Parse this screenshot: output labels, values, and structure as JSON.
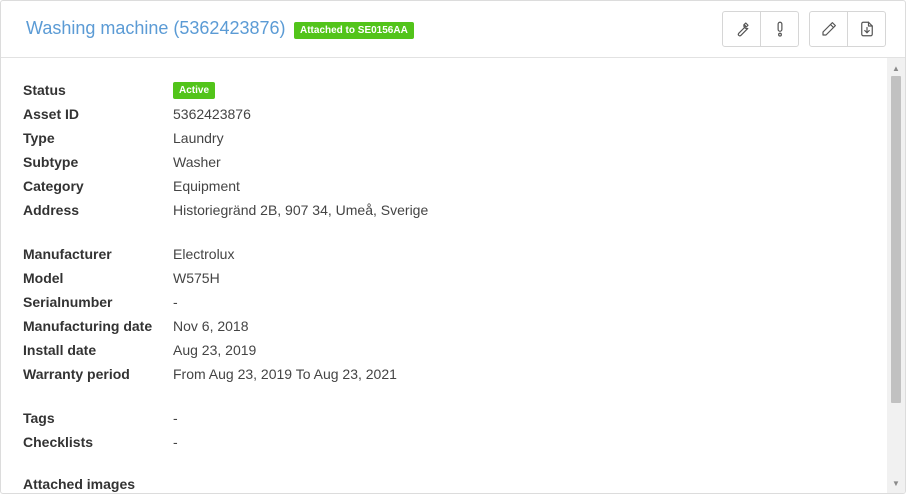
{
  "header": {
    "title": "Washing machine (5362423876)",
    "attached_badge": "Attached to SE0156AA",
    "actions": [
      {
        "name": "wrench-icon",
        "label": "Service"
      },
      {
        "name": "exclamation-icon",
        "label": "Report issue"
      },
      {
        "name": "pencil-icon",
        "label": "Edit"
      },
      {
        "name": "download-icon",
        "label": "Download"
      }
    ]
  },
  "details": {
    "status": {
      "label": "Status",
      "value": "Active"
    },
    "asset_id": {
      "label": "Asset ID",
      "value": "5362423876"
    },
    "type": {
      "label": "Type",
      "value": "Laundry"
    },
    "subtype": {
      "label": "Subtype",
      "value": "Washer"
    },
    "category": {
      "label": "Category",
      "value": "Equipment"
    },
    "address": {
      "label": "Address",
      "value": "Historiegränd 2B, 907 34, Umeå, Sverige"
    },
    "manufacturer": {
      "label": "Manufacturer",
      "value": "Electrolux"
    },
    "model": {
      "label": "Model",
      "value": "W575H"
    },
    "serialnumber": {
      "label": "Serialnumber",
      "value": "-"
    },
    "manufacturing_date": {
      "label": "Manufacturing date",
      "value": "Nov 6, 2018"
    },
    "install_date": {
      "label": "Install date",
      "value": "Aug 23, 2019"
    },
    "warranty_period": {
      "label": "Warranty period",
      "value": "From Aug 23, 2019 To Aug 23, 2021"
    },
    "tags": {
      "label": "Tags",
      "value": "-"
    },
    "checklists": {
      "label": "Checklists",
      "value": "-"
    },
    "attached_images": {
      "label": "Attached images"
    }
  },
  "colors": {
    "title": "#5b9bd5",
    "badge": "#52c41a"
  }
}
